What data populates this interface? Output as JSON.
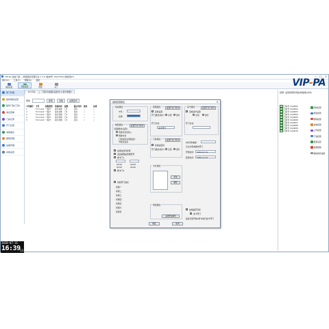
{
  "window": {
    "title": "VIP-PA 动态门禁... 智能园区管理平台 V 3.0 [版本号: WA1456] [授权用户]"
  },
  "menu": [
    "用户(U)",
    "工具(T)",
    "帮助(H)",
    "退出"
  ],
  "toolbar": [
    {
      "label": "系统设置",
      "color": "#4a7fc1"
    },
    {
      "label": "档案设置",
      "color": "#3a9e4f"
    },
    {
      "label": "帮助",
      "color": "#e08a22"
    },
    {
      "label": "关于",
      "color": "#8a8f99"
    }
  ],
  "logo": {
    "main": "VIP",
    "dash": "-",
    "tail": "PA"
  },
  "sidebar": [
    {
      "label": "部门管理",
      "color": "#3b7fd1"
    },
    {
      "label": "临时授权设置",
      "color": "#e0a31c"
    },
    {
      "label": "临时门禁(工具)",
      "color": "#2f9a4a"
    },
    {
      "label": "消息查看",
      "color": "#d14a3b"
    },
    {
      "label": "门禁记录",
      "color": "#7a4fc1"
    },
    {
      "label": "开门记录",
      "color": "#3b7fd1"
    },
    {
      "label": "考勤报表",
      "color": "#2f9a4a"
    },
    {
      "label": "报警管理",
      "color": "#e08a22"
    },
    {
      "label": "设备管理",
      "color": "#3b7fd1"
    },
    {
      "label": "系统设置",
      "color": "#6c7a8c"
    }
  ],
  "clock": {
    "date": "2020-07-31",
    "time": "16:39",
    "sec": "53"
  },
  "main": {
    "tabs": [
      "卡片列表",
      "门禁卡(批量)设置卡(人员卡类型)"
    ],
    "filter": {
      "label": "查找",
      "btn_search": "搜索",
      "btn_clear": "清除",
      "btn_all": "全部显示"
    },
    "columns": [
      "卡号编号",
      "卡号",
      "权限类型",
      "有效时间",
      "权限",
      "截止时间",
      "使用",
      "在线"
    ],
    "rows": [
      [
        "1",
        "Formula1",
        "一般卡",
        "永久有效",
        "门1",
        "永久",
        "✓",
        "✓"
      ],
      [
        "2",
        "Formula2",
        "一般卡",
        "永久有效",
        "门2",
        "永久",
        "✓",
        "✓"
      ],
      [
        "3",
        "Formula3",
        "一般卡",
        "永久有效",
        "门1",
        "永久",
        "✓",
        "✓"
      ],
      [
        "4",
        "Formula4",
        "一般卡",
        "永久有效",
        "门2",
        "永久",
        "✓",
        "✓"
      ],
      [
        "5",
        "Formula5",
        "一般卡",
        "永久有效",
        "门1",
        "永久",
        "✓",
        "✓"
      ]
    ]
  },
  "rightpanel": {
    "title": "权限: 设置权限时间段/模板等(共享)",
    "list": [
      "门禁卡_Vip0001",
      "门禁卡_Vip0002",
      "门禁卡_Vip0003",
      "门禁卡_Vip0004",
      "门禁卡_Vip0005",
      "门禁卡_Vip0006",
      "门禁卡_Vip0007",
      "门禁卡_Vip0008",
      "门禁卡_Vip0009",
      "门禁卡_Vip0010"
    ],
    "actions": [
      {
        "label": "添加权限",
        "color": "#2f9a4a"
      },
      {
        "label": "修改权限",
        "color": "#3b7fd1"
      },
      {
        "label": "删除权限",
        "color": "#d14a3b"
      },
      {
        "label": "复制权限",
        "color": "#e08a22"
      },
      {
        "label": "上传权限",
        "color": "#7a4fc1"
      },
      {
        "label": "下载权限",
        "color": "#3b7fd1"
      },
      {
        "label": "批量设置",
        "color": "#2f9a4a"
      },
      {
        "label": "批量删除",
        "color": "#d14a3b"
      },
      {
        "label": "删除所有权限",
        "color": "#8a8f99"
      }
    ]
  },
  "dialog": {
    "title": "编辑权限属性",
    "close": "×",
    "basic": {
      "caption": "基本属性",
      "no_label": "卡号:",
      "name_label": "名称:"
    },
    "type": {
      "caption": "类型属性",
      "mode_label": "权限模式(设置):",
      "opt1": "普通方式(默认)",
      "opt2": "特殊方式",
      "opt3": "门禁时段(星期设定)",
      "opt4": "节假日设定",
      "btn_time": "设置开关门时间"
    },
    "options": [
      "启用时段同步库",
      "进出权限由管理员开",
      "刷卡门1",
      "刷卡门2"
    ],
    "time_fields": [
      "00:00",
      "00:00",
      "00:00",
      "00:00"
    ],
    "week_caption": "星期开门模式",
    "week_rows": [
      "星期一",
      "星期二",
      "星期三",
      "星期四",
      "星期五",
      "星期六",
      "星期日"
    ],
    "access": {
      "caption": "权限属性",
      "btn_set": "设置开关门时间",
      "chk_enable": "完成设置",
      "open_mode": "开门模式(用户)",
      "opt_all": "全部",
      "opt_part": "部分",
      "open_label": "开门方式:",
      "open_value": "双卡开门"
    },
    "door": {
      "caption": "门禁属性",
      "btn_set": "设置开关门时间",
      "chk": "完成设置时",
      "open_mode": "开门模式(用户)",
      "opt_all": "全部",
      "opt_part": "部分"
    },
    "reader": {
      "caption": "读卡属性",
      "chk": "完成读卡设置",
      "opt_all": "全部",
      "opt_part": "部分",
      "open_label": "开门方式:"
    },
    "card": {
      "caption": "卡片属性",
      "btn_add": "添加",
      "btn_del": "删除"
    },
    "period": {
      "label": "时间(有效期):",
      "chk": "只允许有效期内开门",
      "start": "开始时间:",
      "end": "结束时间:",
      "start_val": "2020-07-31",
      "end_val": "2099-12-31"
    },
    "extra": {
      "caption": "附加属性",
      "chk1": "启用是否同步",
      "chk2": "多卡开门",
      "note": "最多只能开启4张卡进行多卡开门"
    },
    "buttons": {
      "confirm": "确定",
      "cancel": "取消",
      "apply": "设置附加属性"
    }
  }
}
